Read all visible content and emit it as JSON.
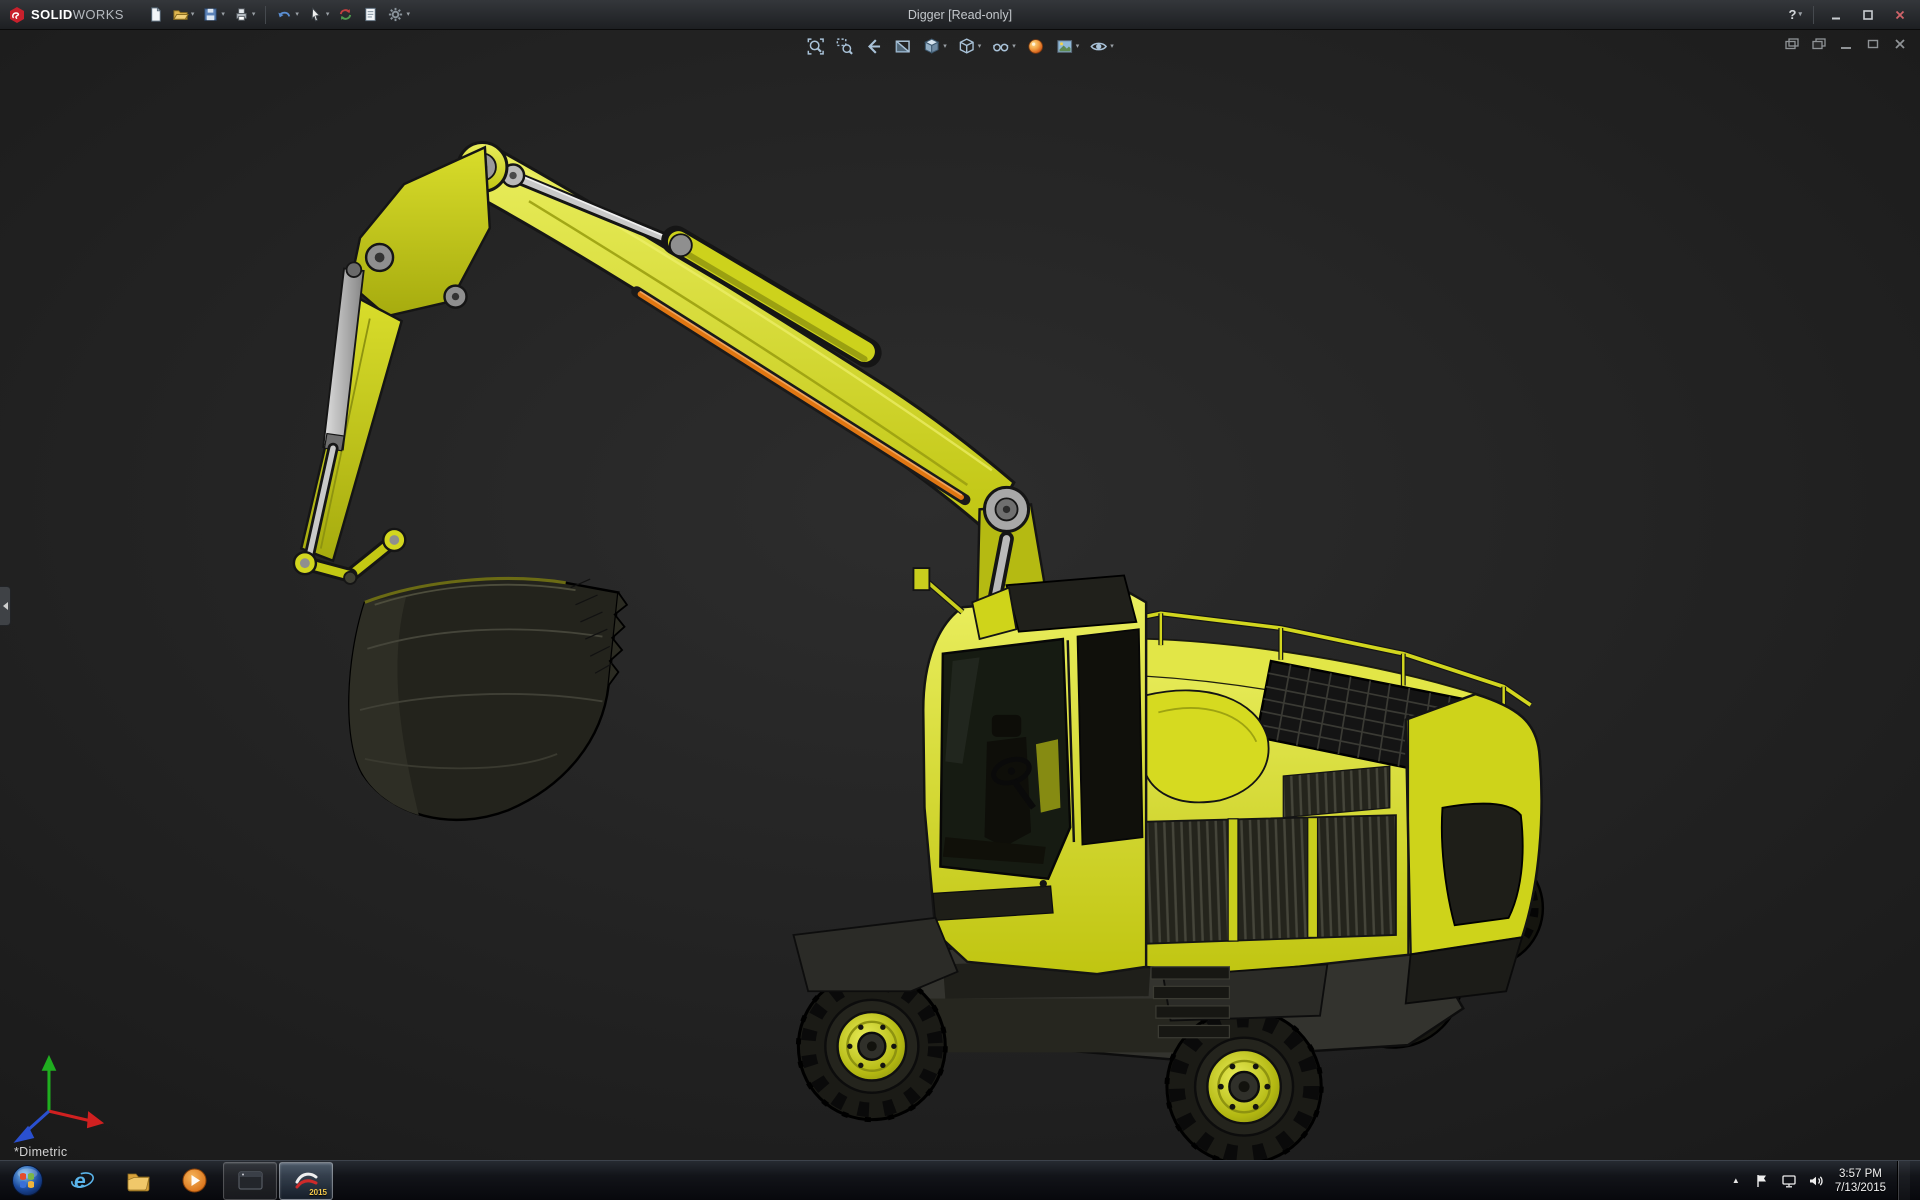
{
  "ui": {
    "caret": "▾",
    "chevron_up": "▲"
  },
  "titlebar": {
    "brand_bold": "SOLID",
    "brand_light": "WORKS",
    "title": "Digger [Read-only]",
    "help": "?",
    "toolbar": [
      {
        "name": "new-document",
        "dropdown": false
      },
      {
        "name": "open",
        "dropdown": true
      },
      {
        "name": "save",
        "dropdown": true
      },
      {
        "name": "print",
        "dropdown": true
      },
      {
        "name": "undo",
        "dropdown": true
      },
      {
        "name": "select",
        "dropdown": true
      },
      {
        "name": "rebuild",
        "dropdown": false
      },
      {
        "name": "file-properties",
        "dropdown": false
      },
      {
        "name": "options",
        "dropdown": true
      }
    ],
    "window_buttons": [
      "help",
      "minimize",
      "maximize",
      "close"
    ]
  },
  "viewport": {
    "view_label": "*Dimetric",
    "hud_buttons": [
      "zoom-to-fit",
      "zoom-to-area",
      "previous-view",
      "section-view",
      "view-orientation",
      "display-style",
      "hide-show-items",
      "edit-appearance",
      "apply-scene",
      "view-settings"
    ],
    "doc_window_buttons": [
      "new-window",
      "cascade-windows",
      "minimize-document",
      "restore-document",
      "close-document"
    ],
    "background_color": "#1e1e1e"
  },
  "model": {
    "subject": "wheeled excavator (Digger) shown in shaded-with-edges dimetric view",
    "body_color": "#d2d61f",
    "body_dark": "#a9ae10",
    "edge_color": "#161616",
    "cab_glass_color": "#171c13",
    "tire_color": "#1b1b16",
    "hydraulic_rod_color": "#c9c9c9",
    "hydraulic_accent": "#e07612",
    "triad_axes": [
      "x-red",
      "y-green",
      "z-blue"
    ]
  },
  "taskbar": {
    "sw_badge": "2015",
    "apps": [
      {
        "name": "internet-explorer",
        "glyph": "e",
        "running": false
      },
      {
        "name": "windows-explorer",
        "running": false
      },
      {
        "name": "media-player",
        "running": false
      },
      {
        "name": "app-window",
        "running": true
      },
      {
        "name": "solidworks-2015",
        "running": true,
        "active": true
      }
    ],
    "tray": {
      "time": "3:57 PM",
      "date": "7/13/2015"
    }
  }
}
